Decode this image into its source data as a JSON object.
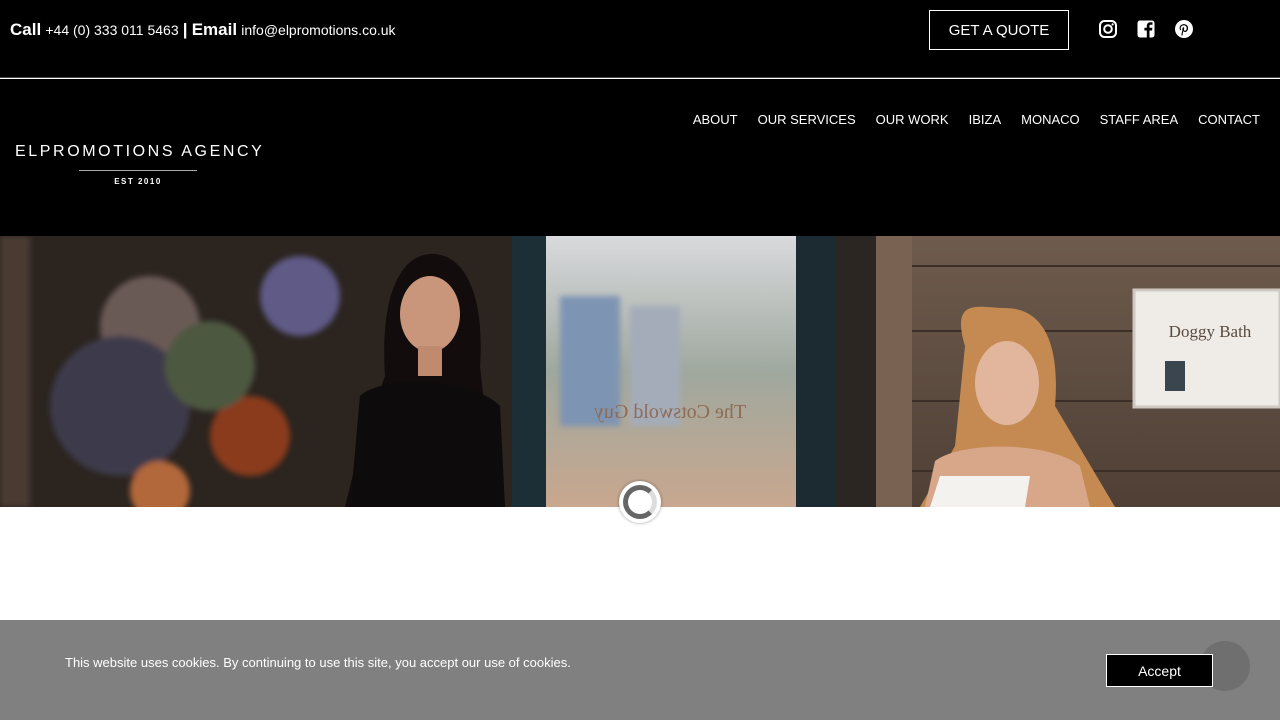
{
  "topbar": {
    "call_label": "Call",
    "phone": "+44 (0) 333 011 5463",
    "separator": "|",
    "email_label": "Email",
    "email": "info@elpromotions.co.uk",
    "quote_button": "GET A QUOTE",
    "social_icons": [
      "instagram-icon",
      "facebook-icon",
      "pinterest-icon"
    ]
  },
  "logo": {
    "title": "ELPROMOTIONS AGENCY",
    "subtitle": "EST 2010"
  },
  "nav": {
    "items": [
      "ABOUT",
      "OUR SERVICES",
      "OUR WORK",
      "IBIZA",
      "MONACO",
      "STAFF AREA",
      "CONTACT"
    ]
  },
  "hero": {
    "sign_text": "Doggy Bath",
    "window_text": "The Cotswold Guy"
  },
  "cookie": {
    "message": "This website uses cookies. By continuing to use this site, you accept our use of cookies.",
    "accept_label": "Accept"
  },
  "colors": {
    "header_bg": "#000000",
    "cookie_bg": "#808080",
    "text": "#ffffff"
  }
}
